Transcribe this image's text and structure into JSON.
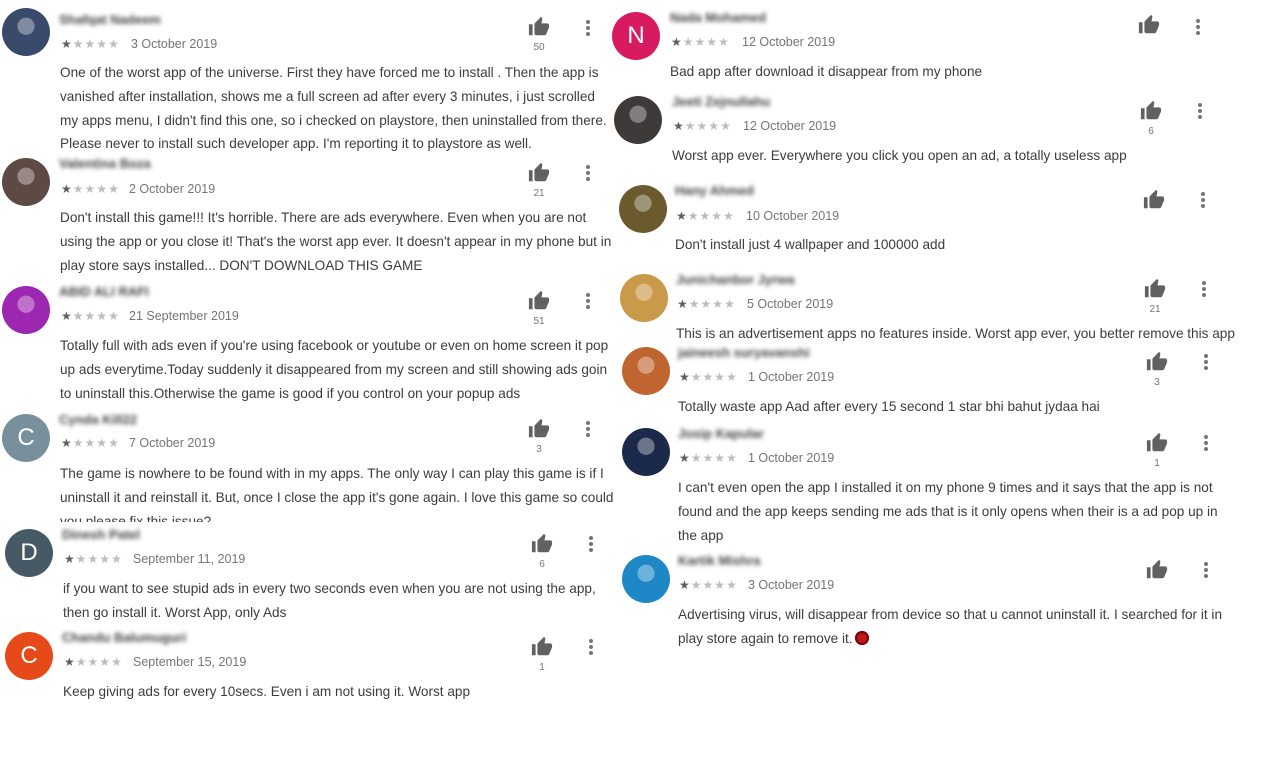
{
  "colors": {
    "star_filled": "#5f5f5f",
    "star_empty": "#bdbdbd",
    "text": "#3c3c3c",
    "meta": "#757575"
  },
  "icons": {
    "like": "thumbs-up-icon",
    "more": "more-vertical-icon"
  },
  "reviews": [
    {
      "name": "Shafqat Nadeem",
      "rating": 1,
      "date": "3 October 2019",
      "likes": "50",
      "avatar": {
        "type": "photo",
        "color": "#3a4a6b",
        "letter": ""
      },
      "text": "One of the worst app of the universe. First they have forced me to install . Then the app is vanished after installation, shows me a full screen ad after every 3 minutes, i just scrolled my apps menu, I didn't find this one, so i checked on playstore, then uninstalled from there. Please never to install such developer app. I'm reporting it to playstore as well."
    },
    {
      "name": "Valentina Boza",
      "rating": 1,
      "date": "2 October 2019",
      "likes": "21",
      "avatar": {
        "type": "photo",
        "color": "#5d4a45",
        "letter": ""
      },
      "text": "Don't install this game!!! It's horrible. There are ads everywhere. Even when you are not using the app or you close it! That's the worst app ever. It doesn't appear in my phone but in play store says installed... DON'T DOWNLOAD THIS GAME"
    },
    {
      "name": "ABID ALI RAFI",
      "rating": 1,
      "date": "21 September 2019",
      "likes": "51",
      "avatar": {
        "type": "photo",
        "color": "#9c27b0",
        "letter": ""
      },
      "text": "Totally full with ads even if you're using facebook or youtube or even on home screen it pop up ads everytime.Today suddenly it disappeared from my screen and still showing ads goin to uninstall this.Otherwise the game is good if you control on your popup ads"
    },
    {
      "name": "Cynda Kill22",
      "rating": 1,
      "date": "7 October 2019",
      "likes": "3",
      "avatar": {
        "type": "letter",
        "color": "#78909c",
        "letter": "C"
      },
      "text": "The game is nowhere to be found with in my apps. The only way I can play this game is if I uninstall it and reinstall it. But, once I close the app it's gone again. I love this game so could you please fix this issue?"
    },
    {
      "name": "Dinesh Patel",
      "rating": 1,
      "date": "September 11, 2019",
      "likes": "6",
      "avatar": {
        "type": "letter",
        "color": "#455a64",
        "letter": "D"
      },
      "text": "if you want to see stupid ads in every two seconds even when you are not using the app, then go install it. Worst App, only Ads"
    },
    {
      "name": "Chandu Balumuguri",
      "rating": 1,
      "date": "September 15, 2019",
      "likes": "1",
      "avatar": {
        "type": "letter",
        "color": "#e64a19",
        "letter": "C"
      },
      "text": "Keep giving ads for every 10secs. Even i am not using it. Worst app"
    },
    {
      "name": "Nada Mohamed",
      "rating": 1,
      "date": "12 October 2019",
      "likes": "",
      "avatar": {
        "type": "letter",
        "color": "#d81b60",
        "letter": "N"
      },
      "text": "Bad app after download it disappear from my phone"
    },
    {
      "name": "Jeeti Zejnullahu",
      "rating": 1,
      "date": "12 October 2019",
      "likes": "6",
      "avatar": {
        "type": "photo",
        "color": "#3e3a38",
        "letter": ""
      },
      "text": "Worst app ever. Everywhere you click you open an ad, a totally useless app"
    },
    {
      "name": "Hany Ahmed",
      "rating": 1,
      "date": "10 October 2019",
      "likes": "",
      "avatar": {
        "type": "photo",
        "color": "#6b5a2e",
        "letter": ""
      },
      "text": "Don't install just 4 wallpaper and 100000 add"
    },
    {
      "name": "Junichanbor Jyrwa",
      "rating": 1,
      "date": "5 October 2019",
      "likes": "21",
      "avatar": {
        "type": "photo",
        "color": "#c99a4a",
        "letter": ""
      },
      "text": "This is an advertisement apps no features inside. Worst app ever, you better remove this app"
    },
    {
      "name": "jaineesh suryavanshi",
      "rating": 1,
      "date": "1 October 2019",
      "likes": "3",
      "avatar": {
        "type": "photo",
        "color": "#c0652f",
        "letter": ""
      },
      "text": "Totally waste app Aad after every 15 second 1 star bhi bahut jydaa hai"
    },
    {
      "name": "Josip Kapular",
      "rating": 1,
      "date": "1 October 2019",
      "likes": "1",
      "avatar": {
        "type": "photo",
        "color": "#1b2a4a",
        "letter": ""
      },
      "text": "I can't even open the app I installed it on my phone 9 times and it says that the app is not found and the app keeps sending me ads that is it only opens when their is a ad pop up in the app"
    },
    {
      "name": "Kartik Mishra",
      "rating": 1,
      "date": "3 October 2019",
      "likes": "",
      "avatar": {
        "type": "photo",
        "color": "#1e88c6",
        "letter": ""
      },
      "text": "Advertising virus, will disappear from device so that u cannot uninstall it. I searched for it in play store again to remove it."
    }
  ]
}
